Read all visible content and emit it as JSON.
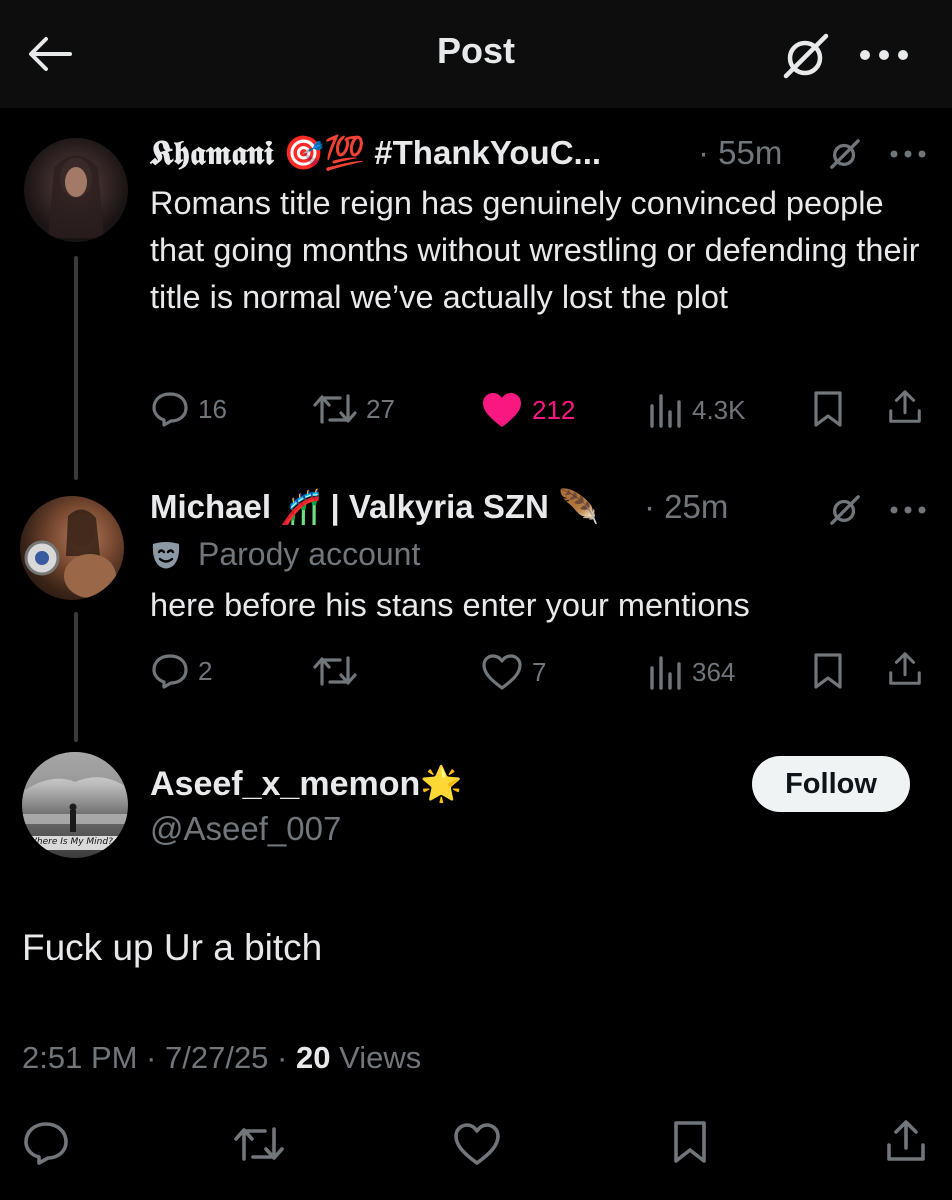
{
  "header": {
    "title": "Post"
  },
  "posts": [
    {
      "display_name": "𝕶𝖍𝖆𝖒𝖆𝖓𝖎 🎯💯 #ThankYouC...",
      "time": "· 55m",
      "text": "Romans title reign has genuinely convinced people that going months without wrestling or defending their title is normal we’ve actually lost the plot",
      "replies": "16",
      "reposts": "27",
      "likes": "212",
      "views": "4.3K"
    },
    {
      "display_name": "Michael 🎢 | Valkyria SZN 🪶",
      "time": "· 25m",
      "parody_label": "Parody account",
      "text": "here before his stans enter your mentions",
      "replies": "2",
      "reposts": "",
      "likes": "7",
      "views": "364"
    }
  ],
  "main_post": {
    "display_name": "Aseef_x_memon🌟",
    "handle": "@Aseef_007",
    "avatar_caption": "Where Is My Mind?",
    "text": "Fuck up Ur a bitch",
    "time": "2:51 PM · 7/27/25 · ",
    "views_count": "20",
    "views_label": " Views",
    "follow_label": "Follow"
  },
  "colors": {
    "like_pink": "#f91880",
    "muted": "#71767b",
    "text": "#e7e9ea"
  }
}
